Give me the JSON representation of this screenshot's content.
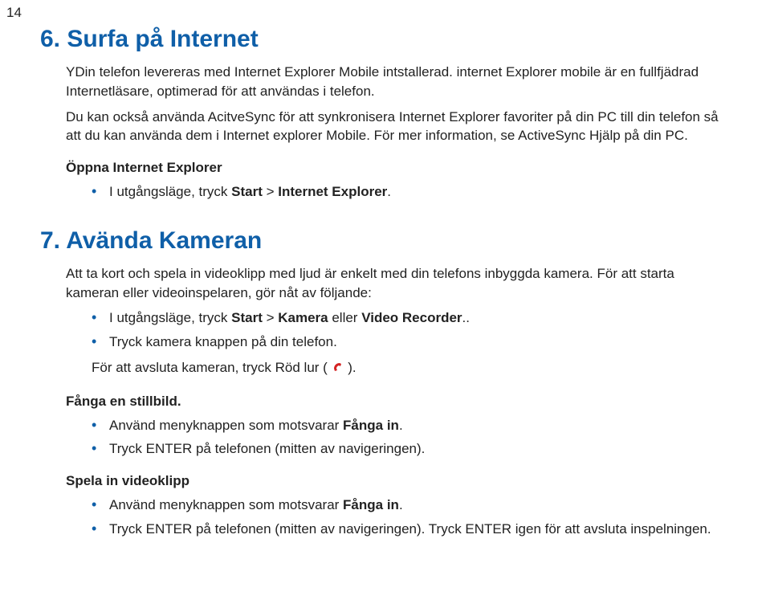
{
  "pageNumber": "14",
  "section6": {
    "title": "6.  Surfa på Internet",
    "p1a": "YDin telefon levereras med Internet Explorer Mobile intstallerad. internet Explorer mobile är en fullfjädrad Internetläsare, optimerad för att användas i telefon.",
    "p1b": "Du kan också använda AcitveSync för att synkronisera Internet Explorer favoriter på din PC till din telefon så att du kan använda dem i Internet explorer Mobile. För mer information, se ActiveSync Hjälp på din PC.",
    "openIE_head": "Öppna Internet Explorer",
    "openIE_b1_pre": "I utgångsläge, tryck ",
    "openIE_b1_bold1": "Start",
    "openIE_b1_mid": " > ",
    "openIE_b1_bold2": "Internet Explorer",
    "openIE_b1_post": "."
  },
  "section7": {
    "title": "7.  Avända Kameran",
    "p1": "Att ta kort och spela in videoklipp med ljud är enkelt med din telefons inbyggda kamera. För att starta kameran eller videoinspelaren, gör nåt av följande:",
    "b1_pre": "I utgångsläge, tryck ",
    "b1_bold1": "Start",
    "b1_mid1": " > ",
    "b1_bold2": "Kamera",
    "b1_mid2": " eller ",
    "b1_bold3": "Video Recorder",
    "b1_post": "..",
    "b2": "Tryck kamera knappen på din telefon.",
    "closeCam_pre": "För att avsluta kameran, tryck Röd lur ( ",
    "closeCam_post": " ).",
    "still_head": "Fånga en stillbild.",
    "still_b1_pre": "Använd menyknappen som motsvarar ",
    "still_b1_bold": "Fånga in",
    "still_b1_post": ".",
    "still_b2": "Tryck ENTER på telefonen (mitten av navigeringen).",
    "video_head": "Spela in videoklipp",
    "video_b1_pre": "Använd menyknappen som motsvarar ",
    "video_b1_bold": "Fånga in",
    "video_b1_post": ".",
    "video_b2": "Tryck ENTER på telefonen (mitten av navigeringen). Tryck ENTER igen för att avsluta inspelningen."
  }
}
